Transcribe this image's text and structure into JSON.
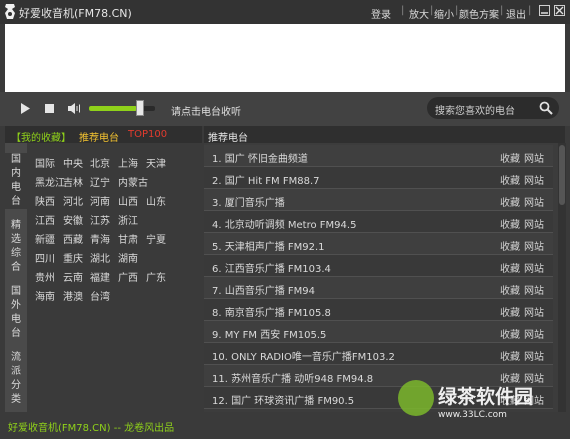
{
  "title": "好爱收音机(FM78.CN)",
  "titlebar_links": [
    "登录",
    "放大",
    "缩小",
    "颜色方案",
    "退出"
  ],
  "player": {
    "hint": "请点击电台收听",
    "volume_fraction": 0.72
  },
  "search": {
    "placeholder": "搜索您喜欢的电台"
  },
  "left_tabs": [
    "【我的收藏】",
    "推荐电台",
    "TOP100"
  ],
  "left_tab_colors": [
    "#8fd11a",
    "#f2c230",
    "#e23b2e"
  ],
  "vertical_tabs": [
    "国内电台",
    "精选综合",
    "国外电台",
    "流派分类"
  ],
  "regions": [
    [
      "国际",
      "中央",
      "北京",
      "上海",
      "天津"
    ],
    [
      "黑龙江",
      "吉林",
      "辽宁",
      "内蒙古"
    ],
    [
      "陕西",
      "河北",
      "河南",
      "山西",
      "山东"
    ],
    [
      "江西",
      "安徽",
      "江苏",
      "浙江"
    ],
    [
      "新疆",
      "西藏",
      "青海",
      "甘肃",
      "宁夏"
    ],
    [
      "四川",
      "重庆",
      "湖北",
      "湖南"
    ],
    [
      "贵州",
      "云南",
      "福建",
      "广西",
      "广东"
    ],
    [
      "海南",
      "港澳",
      "台湾"
    ]
  ],
  "station_header": "推荐电台",
  "fav_label": "收藏",
  "site_label": "网站",
  "stations": [
    "1. 国广 怀旧金曲频道",
    "2. 国广 Hit FM FM88.7",
    "3. 厦门音乐广播",
    "4. 北京动听调频 Metro FM94.5",
    "5. 天津相声广播 FM92.1",
    "6. 江西音乐广播 FM103.4",
    "7. 山西音乐广播 FM94",
    "8. 南京音乐广播 FM105.8",
    "9. MY FM 西安 FM105.5",
    "10. ONLY RADIO唯一音乐广播FM103.2",
    "11. 苏州音乐广播 动听948 FM94.8",
    "12. 国广 环球资讯广播 FM90.5"
  ],
  "footer": "好爱收音机(FM78.CN) -- 龙卷风出品",
  "watermark": {
    "name": "绿茶软件园",
    "url": "www.33LC.com"
  },
  "colors": {
    "accent_green": "#8fd11a"
  }
}
